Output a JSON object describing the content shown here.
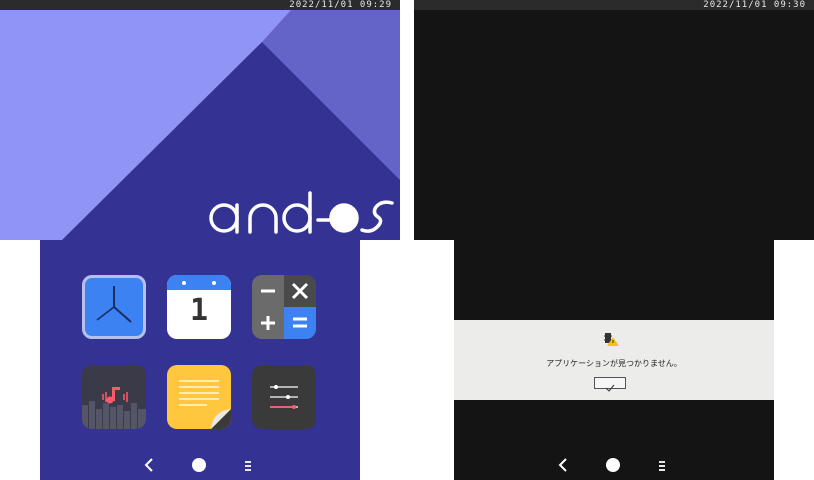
{
  "left_device": {
    "status_time": "2022/11/01 09:29",
    "logo_text": "and-os",
    "apps": [
      {
        "name": "clock",
        "icon": "clock-icon"
      },
      {
        "name": "calendar",
        "icon": "calendar-icon",
        "day": "1"
      },
      {
        "name": "calculator",
        "icon": "calculator-icon"
      },
      {
        "name": "music",
        "icon": "music-icon"
      },
      {
        "name": "notes",
        "icon": "notes-icon"
      },
      {
        "name": "settings",
        "icon": "sliders-icon"
      }
    ],
    "nav": {
      "back": "‹",
      "home": "●",
      "menu": "≡"
    }
  },
  "right_device": {
    "status_time": "2022/11/01 09:30",
    "dialog": {
      "icon": "warning-icon",
      "message": "アプリケーションが見つかりません。",
      "ok_icon": "check-icon"
    }
  },
  "colors": {
    "wallpaper_light": "#9094f4",
    "wallpaper_mid": "#6363c8",
    "wallpaper_dark": "#343393",
    "homescreen_bg": "#343393",
    "status_bar": "#2b2b2b",
    "right_bg": "#141414"
  }
}
